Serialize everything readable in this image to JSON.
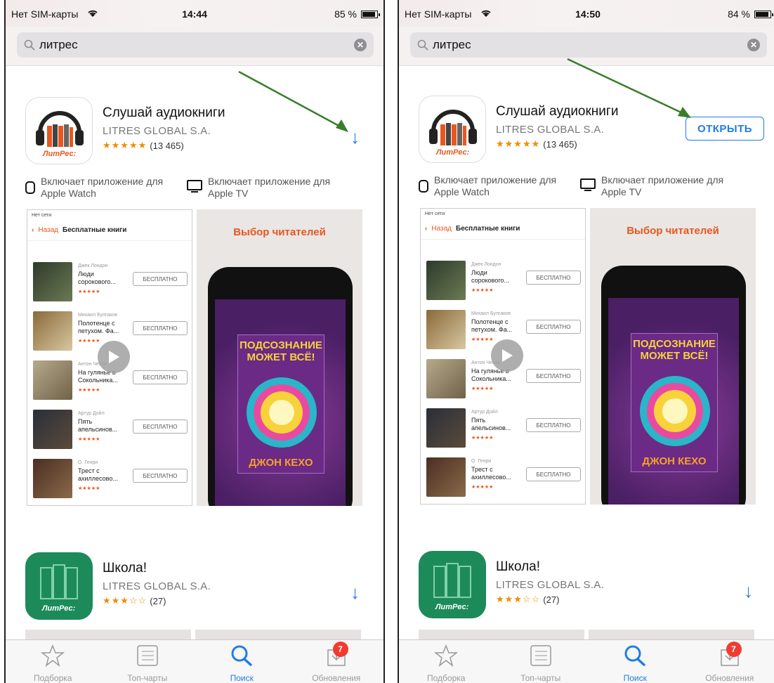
{
  "colors": {
    "accent": "#1f7ce8",
    "annotation_arrow": "#3a7d2a",
    "badge": "#f23b30",
    "brand_orange": "#e8571f",
    "star": "#f08c00"
  },
  "phones": [
    {
      "status": {
        "carrier": "Нет SIM-карты",
        "time": "14:44",
        "battery": "85 %"
      },
      "search": {
        "query": "литрес"
      },
      "app1": {
        "title": "Слушай аудиокниги",
        "developer": "LITRES GLOBAL S.A.",
        "rating_count": "(13 465)",
        "stars": "★★★★★",
        "icon_text": "ЛитРес:",
        "action_icon": "download-arrow-icon"
      },
      "features": {
        "watch": "Включает приложение для Apple Watch",
        "tv": "Включает приложение для Apple TV"
      },
      "screenshot1": {
        "status": "Нет сети",
        "back": "Назад",
        "title": "Бесплатные книги",
        "books": [
          {
            "author": "Джек Лондон",
            "title": "Люди сорокового...",
            "stars": "★★★★★",
            "button": "БЕСПЛАТНО"
          },
          {
            "author": "Михаил Булгаков",
            "title": "Полотенце с петухом. Фа...",
            "stars": "★★★★★",
            "button": "БЕСПЛАТНО"
          },
          {
            "author": "Антон Чехов",
            "title": "На гулянье в Сокольника...",
            "stars": "★★★★★",
            "button": "БЕСПЛАТНО"
          },
          {
            "author": "Артур Дойл",
            "title": "Пять апельсинов...",
            "stars": "★★★★★",
            "button": "БЕСПЛАТНО"
          },
          {
            "author": "О. Генри",
            "title": "Трест с ахиллесово...",
            "stars": "★★★★★",
            "button": "БЕСПЛАТНО"
          }
        ]
      },
      "screenshot2": {
        "title": "Выбор читателей",
        "cover_top": "ПОДСОЗНАНИЕ МОЖЕТ ВСЁ!",
        "cover_bottom": "ДЖОН КЕХО"
      },
      "app2": {
        "title": "Школа!",
        "developer": "LITRES GLOBAL S.A.",
        "rating_count": "(27)",
        "stars": "★★★☆☆",
        "icon_text": "ЛитРес:"
      },
      "tabs": [
        {
          "label": "Подборка",
          "icon": "star-icon"
        },
        {
          "label": "Топ-чарты",
          "icon": "list-icon"
        },
        {
          "label": "Поиск",
          "icon": "search-icon"
        },
        {
          "label": "Обновления",
          "icon": "updates-icon",
          "badge": "7"
        }
      ]
    },
    {
      "status": {
        "carrier": "Нет SIM-карты",
        "time": "14:50",
        "battery": "84 %"
      },
      "search": {
        "query": "литрес"
      },
      "app1": {
        "title": "Слушай аудиокниги",
        "developer": "LITRES GLOBAL S.A.",
        "rating_count": "(13 465)",
        "stars": "★★★★★",
        "icon_text": "ЛитРес:",
        "action_label": "ОТКРЫТЬ"
      },
      "features": {
        "watch": "Включает приложение для Apple Watch",
        "tv": "Включает приложение для Apple TV"
      },
      "screenshot1": {
        "status": "Нет сети",
        "back": "Назад",
        "title": "Бесплатные книги",
        "books": [
          {
            "author": "Джек Лондон",
            "title": "Люди сорокового...",
            "stars": "★★★★★",
            "button": "БЕСПЛАТНО"
          },
          {
            "author": "Михаил Булгаков",
            "title": "Полотенце с петухом. Фа...",
            "stars": "★★★★★",
            "button": "БЕСПЛАТНО"
          },
          {
            "author": "Антон Чехов",
            "title": "На гулянье в Сокольника...",
            "stars": "★★★★★",
            "button": "БЕСПЛАТНО"
          },
          {
            "author": "Артур Дойл",
            "title": "Пять апельсинов...",
            "stars": "★★★★★",
            "button": "БЕСПЛАТНО"
          },
          {
            "author": "О. Генри",
            "title": "Трест с ахиллесово...",
            "stars": "★★★★★",
            "button": "БЕСПЛАТНО"
          }
        ]
      },
      "screenshot2": {
        "title": "Выбор читателей",
        "cover_top": "ПОДСОЗНАНИЕ МОЖЕТ ВСЁ!",
        "cover_bottom": "ДЖОН КЕХО"
      },
      "app2": {
        "title": "Школа!",
        "developer": "LITRES GLOBAL S.A.",
        "rating_count": "(27)",
        "stars": "★★★☆☆",
        "icon_text": "ЛитРес:"
      },
      "tabs": [
        {
          "label": "Подборка",
          "icon": "star-icon"
        },
        {
          "label": "Топ-чарты",
          "icon": "list-icon"
        },
        {
          "label": "Поиск",
          "icon": "search-icon"
        },
        {
          "label": "Обновления",
          "icon": "updates-icon",
          "badge": "7"
        }
      ]
    }
  ]
}
